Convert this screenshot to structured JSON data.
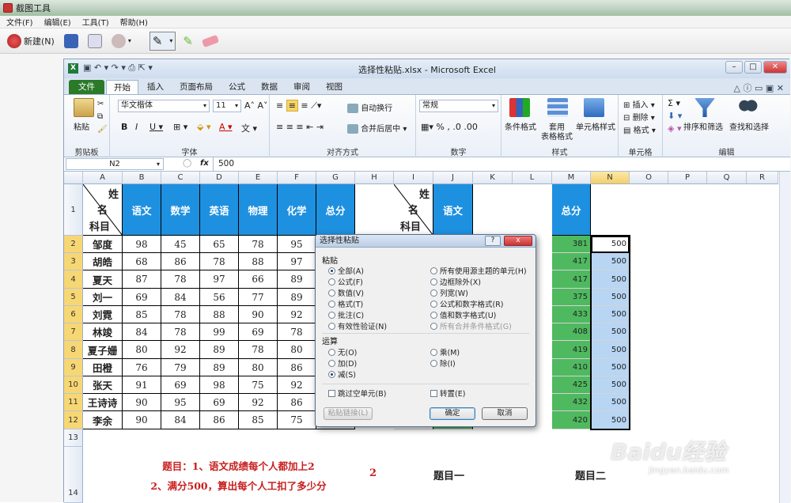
{
  "snip": {
    "title": "截图工具",
    "menu": [
      "文件(F)",
      "编辑(E)",
      "工具(T)",
      "帮助(H)"
    ],
    "new_label": "新建(N)"
  },
  "excel": {
    "title": "选择性粘贴.xlsx - Microsoft Excel",
    "tabs": [
      "文件",
      "开始",
      "插入",
      "页面布局",
      "公式",
      "数据",
      "审阅",
      "视图"
    ],
    "ribbon": {
      "paste": "粘贴",
      "clipboard": "剪贴板",
      "font_name": "华文楷体",
      "font_size": "11",
      "font_group": "字体",
      "wrap": "自动换行",
      "merge": "合并后居中",
      "align_group": "对齐方式",
      "number_format": "常规",
      "number_group": "数字",
      "cond_format": "条件格式",
      "table_format_1": "套用",
      "table_format_2": "表格格式",
      "cell_style": "单元格样式",
      "style_group": "样式",
      "insert": "插入",
      "delete": "删除",
      "format": "格式",
      "cells_group": "单元格",
      "sort_filter": "排序和筛选",
      "find_select": "查找和选择",
      "edit_group": "编辑"
    },
    "name_box": "N2",
    "fx": "fx",
    "formula": "500",
    "columns": [
      "A",
      "B",
      "C",
      "D",
      "E",
      "F",
      "G",
      "H",
      "I",
      "J",
      "K",
      "L",
      "M",
      "N",
      "O",
      "P",
      "Q",
      "R"
    ],
    "row_numbers": [
      "1",
      "2",
      "3",
      "4",
      "5",
      "6",
      "7",
      "8",
      "9",
      "10",
      "11",
      "12",
      "13",
      "14"
    ],
    "corner_labels": {
      "name": "姓",
      "name2": "名",
      "subject": "科目"
    },
    "headers": [
      "语文",
      "数学",
      "英语",
      "物理",
      "化学",
      "总分"
    ],
    "i_header": "语文",
    "m_header": "总分",
    "students": [
      {
        "name": "邹度",
        "scores": [
          "98",
          "45",
          "65",
          "78",
          "95"
        ],
        "total": "381",
        "n": "500"
      },
      {
        "name": "胡皓",
        "scores": [
          "68",
          "86",
          "78",
          "88",
          "97"
        ],
        "total": "417",
        "n": "500"
      },
      {
        "name": "夏天",
        "scores": [
          "87",
          "78",
          "97",
          "66",
          "89"
        ],
        "total": "417",
        "n": "500"
      },
      {
        "name": "刘一",
        "scores": [
          "69",
          "84",
          "56",
          "77",
          "89"
        ],
        "total": "375",
        "n": "500"
      },
      {
        "name": "刘霓",
        "scores": [
          "85",
          "78",
          "88",
          "90",
          "92"
        ],
        "total": "433",
        "n": "500"
      },
      {
        "name": "林竣",
        "scores": [
          "84",
          "78",
          "99",
          "69",
          "78"
        ],
        "total": "408",
        "n": "500"
      },
      {
        "name": "夏子姗",
        "scores": [
          "80",
          "92",
          "89",
          "78",
          "80"
        ],
        "total": "419",
        "n": "500"
      },
      {
        "name": "田橙",
        "scores": [
          "76",
          "79",
          "89",
          "80",
          "86"
        ],
        "total": "410",
        "n": "500"
      },
      {
        "name": "张天",
        "scores": [
          "91",
          "69",
          "98",
          "75",
          "92"
        ],
        "total": "425",
        "n": "500"
      },
      {
        "name": "王诗诗",
        "scores": [
          "90",
          "95",
          "69",
          "92",
          "86"
        ],
        "total": "432",
        "n": "500"
      },
      {
        "name": "李余",
        "scores": [
          "90",
          "84",
          "86",
          "85",
          "75"
        ],
        "total": "420",
        "n": "500"
      }
    ],
    "note_line1": "题目：1、语文成绩每个人都加上2",
    "note_line2": "2、满分500，算出每个人工扣了多少分",
    "note_num": "2",
    "q1": "题目一",
    "q2": "题目二"
  },
  "dialog": {
    "title": "选择性粘贴",
    "help": "?",
    "close": "x",
    "paste_section": "粘贴",
    "paste_left": [
      "全部(A)",
      "公式(F)",
      "数值(V)",
      "格式(T)",
      "批注(C)",
      "有效性验证(N)"
    ],
    "paste_right": [
      "所有使用源主题的单元(H)",
      "边框除外(X)",
      "列宽(W)",
      "公式和数字格式(R)",
      "值和数字格式(U)",
      "所有合并条件格式(G)"
    ],
    "op_section": "运算",
    "op_left": [
      "无(O)",
      "加(D)",
      "减(S)"
    ],
    "op_right": [
      "乘(M)",
      "除(I)"
    ],
    "skip_blanks": "跳过空单元(B)",
    "transpose": "转置(E)",
    "paste_link": "粘贴链接(L)",
    "ok": "确定",
    "cancel": "取消"
  },
  "watermark": {
    "brand": "Baidu经验",
    "url": "jingyan.baidu.com"
  },
  "colors": {
    "header_blue": "#1e90e0",
    "total_green": "#4fb960",
    "n_blue": "#b8d5f3",
    "note_red": "#c81e1e"
  }
}
